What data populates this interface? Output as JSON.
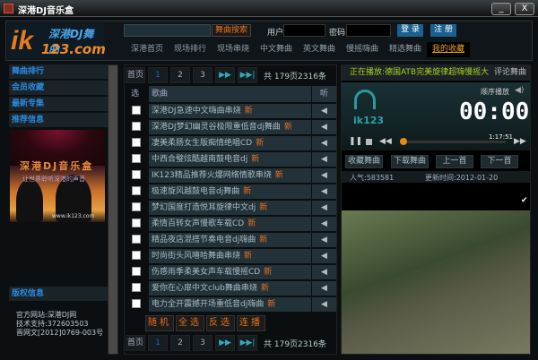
{
  "window": {
    "title": "深港DJ音乐盒",
    "minimize": "_",
    "close": "X"
  },
  "logo": {
    "big": "ik",
    "dj": "深港DJ舞曲",
    "com": "123.com"
  },
  "search": {
    "value": "",
    "button": "舞曲搜索"
  },
  "login": {
    "user_label": "用户:",
    "password_label": "密码:",
    "login": "登 录",
    "register": "注 册"
  },
  "nav": [
    "深港首页",
    "现场排行",
    "现场串烧",
    "中文舞曲",
    "英文舞曲",
    "慢摇嗨曲",
    "精选舞曲",
    "我的收藏"
  ],
  "nav_active": "我的收藏",
  "sidebar": {
    "items": [
      "舞曲排行",
      "会员收藏",
      "最新专集",
      "推荐信息"
    ],
    "poster": {
      "title": "深港DJ音乐盒",
      "subtitle": "让世界聆听深港的声音",
      "url": "www.ik123.com"
    },
    "copyright_title": "版权信息",
    "copyright": [
      "官方网站:深港DJ网",
      "技术支持:372603503",
      "晋网文[2012]0769-003号"
    ]
  },
  "pager": {
    "first": "首页",
    "pages": [
      "1",
      "2",
      "3"
    ],
    "current": "1",
    "next": "▶▶",
    "last": "▶▶|",
    "summary": "共 179页2316条"
  },
  "list": {
    "col_select": "选",
    "col_song": "歌曲",
    "col_listen": "听",
    "new_tag": "新",
    "songs": [
      "深港DJ急速中文嗨曲串烧",
      "深港DJ梦幻幽灵谷极限重低音dj舞曲",
      "凄美柔肠女生版痴情绝唱CD",
      "中西合璧炫酷越南鼓电音dj",
      "IK123精品推荐火爆网络情歌串烧",
      "极速旋风越鼓电音dj舞曲",
      "梦幻国度打造悦耳旋律中文dj",
      "柔情百转女声慢歌车载CD",
      "精品夜店混搭节奏电音dj嗨曲",
      "时尚街头风嘻哈舞曲串烧",
      "伤感雨季柔美女声车载慢摇CD",
      "爱你在心扉中文club舞曲串烧",
      "电力全开震撼开场重低音dj嗨曲"
    ],
    "actions": [
      "随机",
      "全选",
      "反选",
      "连播"
    ]
  },
  "player": {
    "now_playing": "正在播放:德国ATB完美旋律超嗨慢摇大",
    "comment": "评论舞曲",
    "mode": "顺序播放",
    "time": "00:00",
    "duration": "1:17:51",
    "progress": 0,
    "brand": "ik123",
    "buttons": [
      "收藏舞曲",
      "下载舞曲",
      "上一首",
      "下一首"
    ],
    "popularity": "人气:583581",
    "updated": "更新时间:2012-01-20"
  },
  "colors": {
    "accent": "#e8701c",
    "link": "#2a8ae0",
    "now_playing": "#a8d020"
  }
}
